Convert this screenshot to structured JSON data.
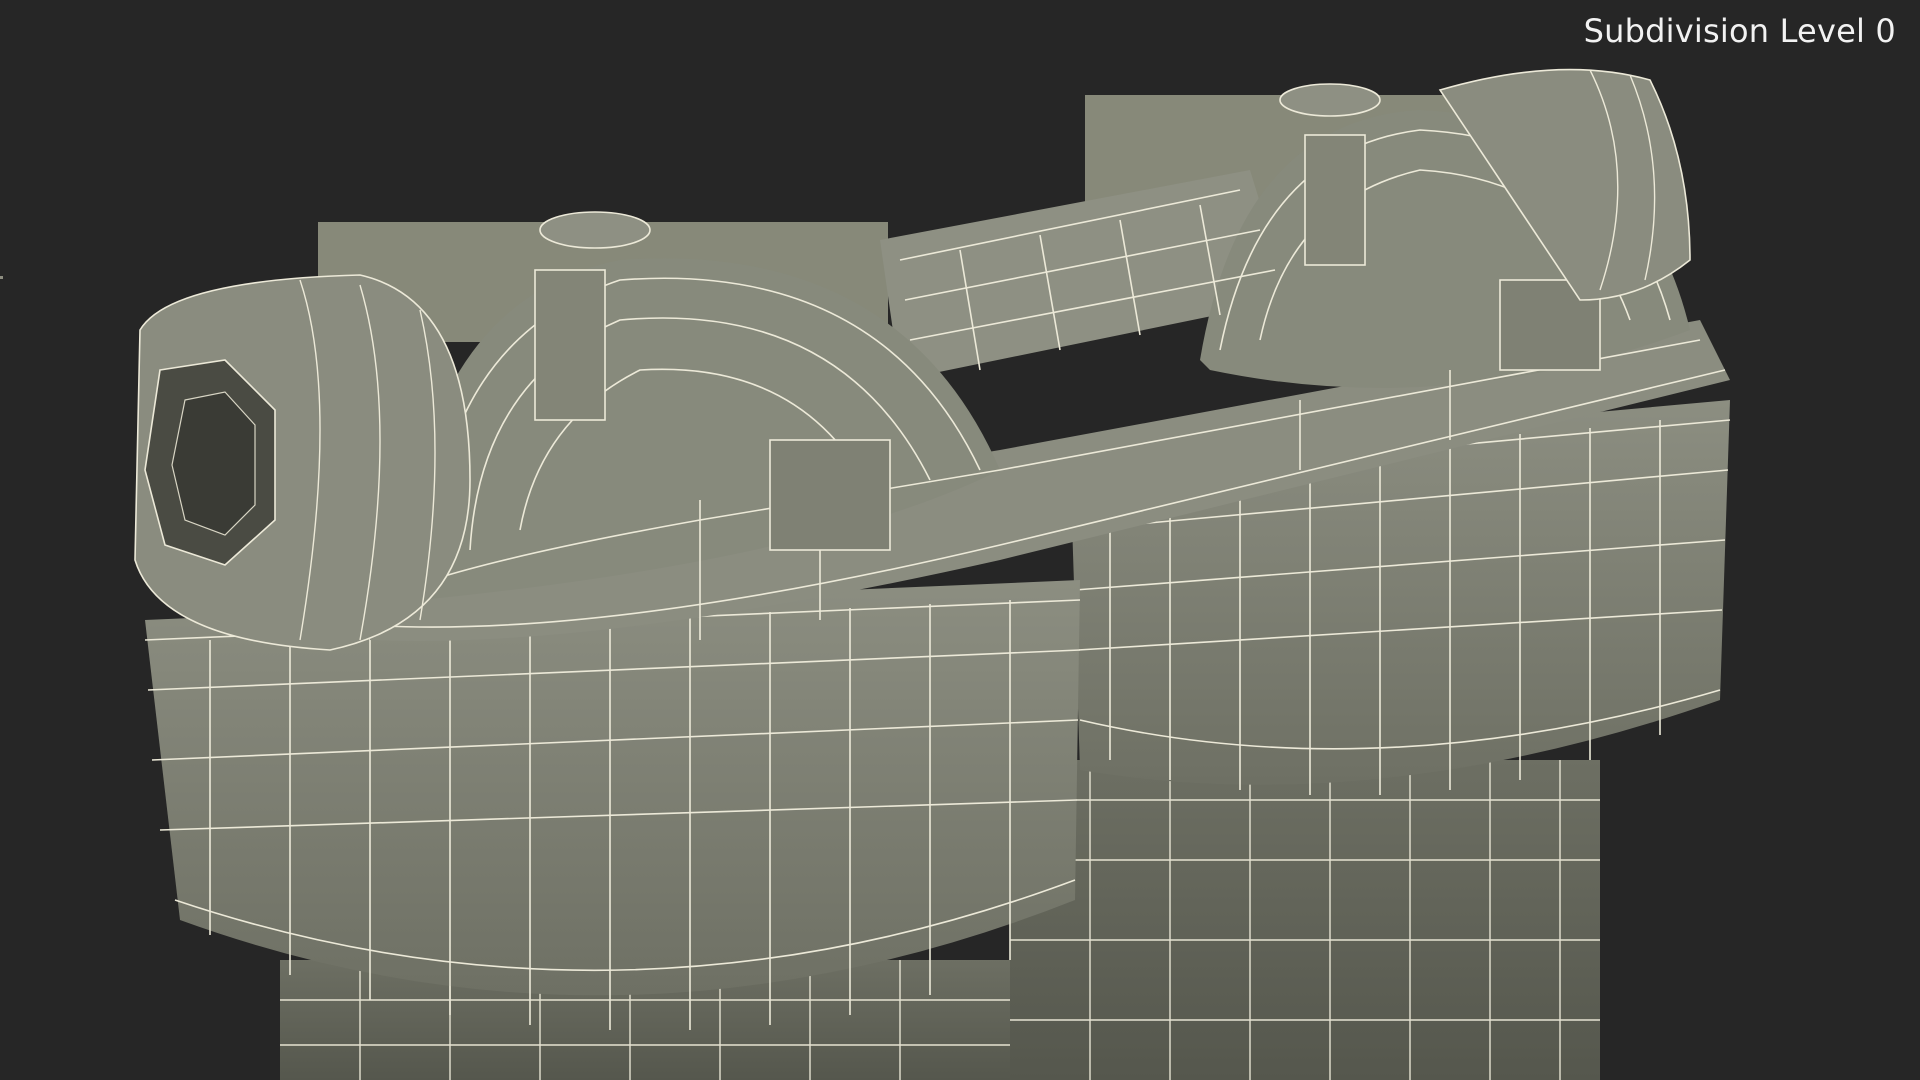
{
  "viewport": {
    "overlay_label": "Subdivision Level 0",
    "background_color": "#262626",
    "model_color": "#7d7f72",
    "wire_color": "#ece9d8"
  },
  "scene": {
    "subject": "twin filter housing wireframe render"
  }
}
